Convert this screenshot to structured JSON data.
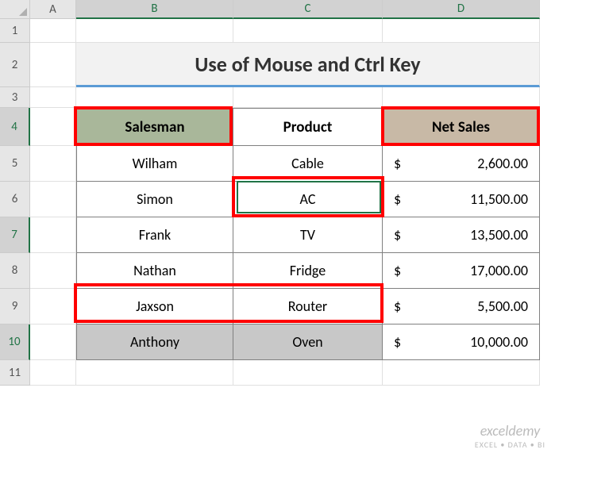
{
  "columns": [
    "A",
    "B",
    "C",
    "D"
  ],
  "rows": [
    "1",
    "2",
    "3",
    "4",
    "5",
    "6",
    "7",
    "8",
    "9",
    "10",
    "11"
  ],
  "title": "Use of Mouse and Ctrl Key",
  "headers": {
    "b": "Salesman",
    "c": "Product",
    "d": "Net Sales"
  },
  "currency": "$",
  "data": [
    {
      "salesman": "Wilham",
      "product": "Cable",
      "net": "2,600.00"
    },
    {
      "salesman": "Simon",
      "product": "AC",
      "net": "11,500.00"
    },
    {
      "salesman": "Frank",
      "product": "TV",
      "net": "13,500.00"
    },
    {
      "salesman": "Nathan",
      "product": "Fridge",
      "net": "17,000.00"
    },
    {
      "salesman": "Jaxson",
      "product": "Router",
      "net": "5,500.00"
    },
    {
      "salesman": "Anthony",
      "product": "Oven",
      "net": "10,000.00"
    }
  ],
  "watermark": {
    "brand": "exceldemy",
    "tagline": "EXCEL • DATA • BI"
  },
  "chart_data": {
    "type": "table",
    "title": "Use of Mouse and Ctrl Key",
    "columns": [
      "Salesman",
      "Product",
      "Net Sales"
    ],
    "rows": [
      [
        "Wilham",
        "Cable",
        2600.0
      ],
      [
        "Simon",
        "AC",
        11500.0
      ],
      [
        "Frank",
        "TV",
        13500.0
      ],
      [
        "Nathan",
        "Fridge",
        17000.0
      ],
      [
        "Jaxson",
        "Router",
        5500.0
      ],
      [
        "Anthony",
        "Oven",
        10000.0
      ]
    ]
  }
}
